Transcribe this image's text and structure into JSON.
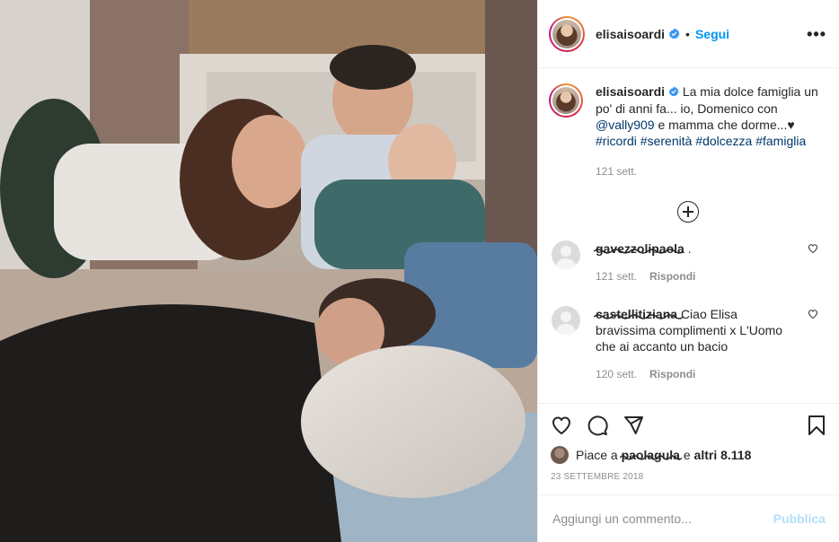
{
  "post": {
    "username": "elisaisoardi",
    "follow_label": "Segui",
    "separator": "•",
    "more_icon": "more-horizontal-icon",
    "verified_color": "#3897f0"
  },
  "caption": {
    "username": "elisaisoardi",
    "text_1": "La mia dolce famiglia un po' di anni fa... io, Domenico con",
    "mention": "@vally909",
    "text_2": "e mamma che dorme...♥",
    "hashtags": [
      "#ricordi",
      "#serenità",
      "#dolcezza",
      "#famiglia"
    ],
    "time": "121 sett."
  },
  "comments": [
    {
      "username": "gavezzolipaola",
      "text": ".",
      "time": "121 sett.",
      "reply_label": "Rispondi"
    },
    {
      "username": "castellitiziana",
      "text": "Ciao Elisa bravissima complimenti x L'Uomo che ai accanto un bacio",
      "time": "120 sett.",
      "reply_label": "Rispondi"
    }
  ],
  "likes": {
    "prefix": "Piace a",
    "user": "paolagula",
    "conjunction": "e",
    "others": "altri 8.118"
  },
  "date": "23 SETTEMBRE 2018",
  "add_comment": {
    "placeholder": "Aggiungi un commento...",
    "publish_label": "Pubblica"
  },
  "colors": {
    "link_blue": "#0095f6",
    "tag_blue": "#00376b",
    "muted": "#8e8e8e",
    "publish_disabled": "#b2dffc"
  }
}
